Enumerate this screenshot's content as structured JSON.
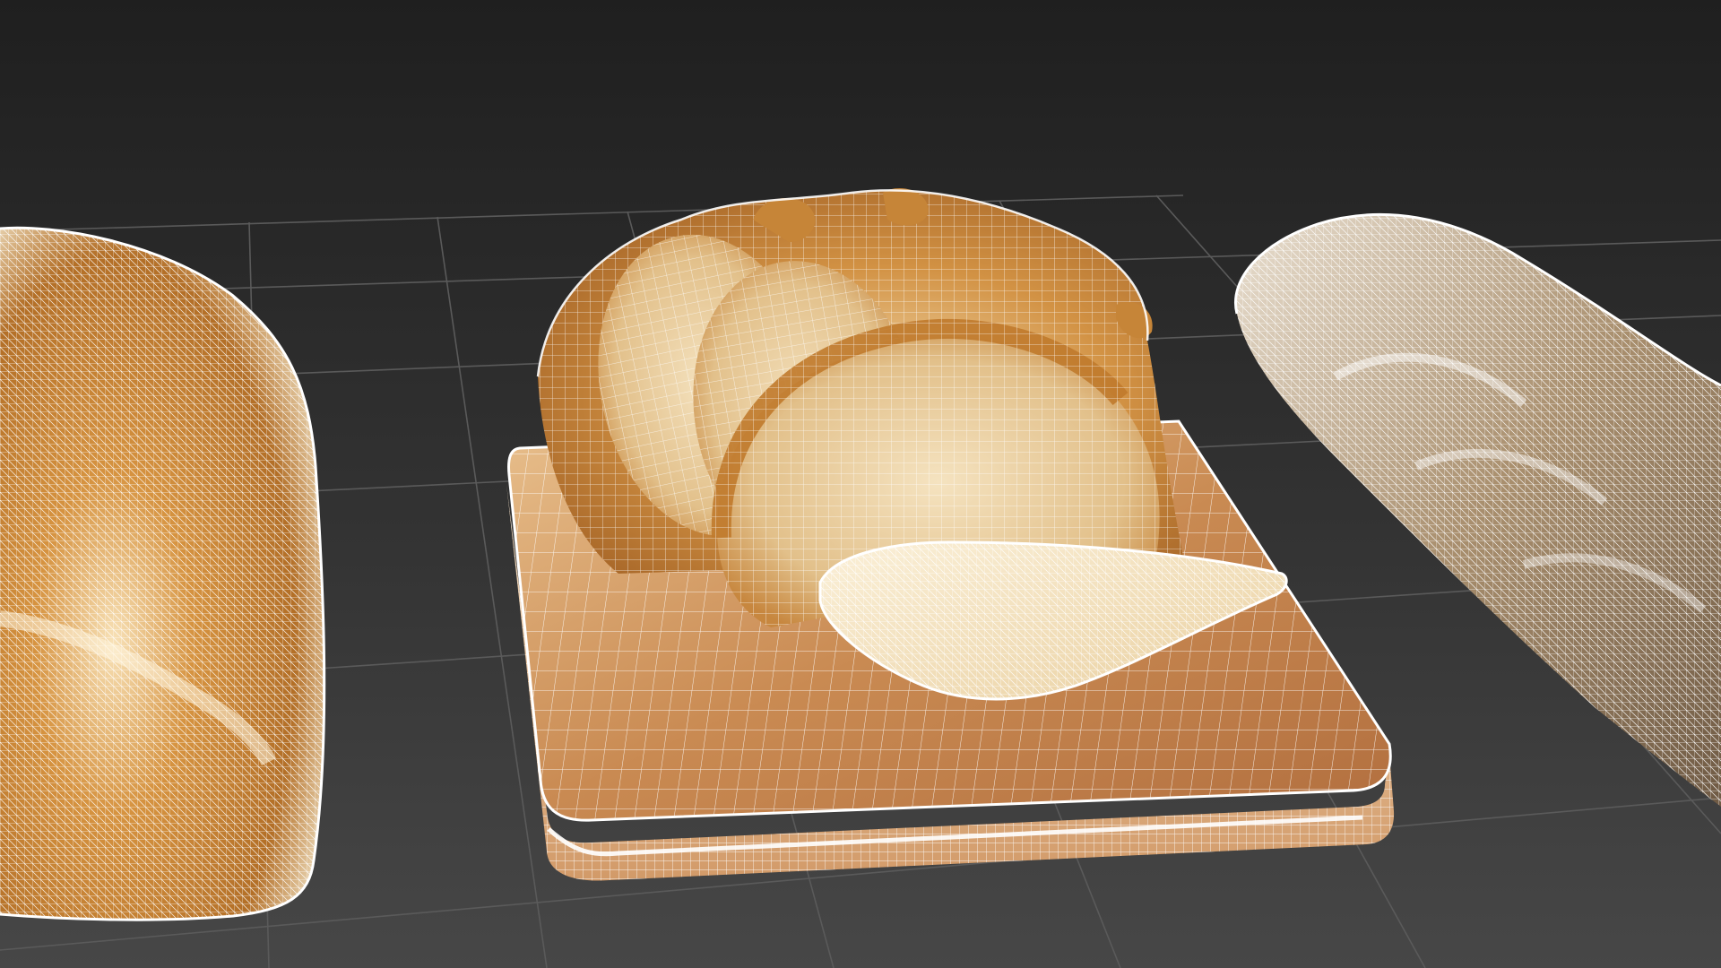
{
  "viewport": {
    "view": "perspective",
    "shading": "textured-with-wireframe",
    "grid": true,
    "colors": {
      "background_top": "#1f1f1f",
      "background_bottom": "#454545",
      "grid_line": "#5a5a5a",
      "wire": "#ffffff",
      "crust_dark": "#a8621f",
      "crust_mid": "#d08b3a",
      "crumb": "#f1d9a7",
      "board_light": "#e6b98a",
      "board_dark": "#b06c3d"
    },
    "objects": [
      "bread-loaf-left",
      "sliced-round-loaf",
      "bread-slice",
      "cutting-board",
      "baguette-right"
    ]
  }
}
